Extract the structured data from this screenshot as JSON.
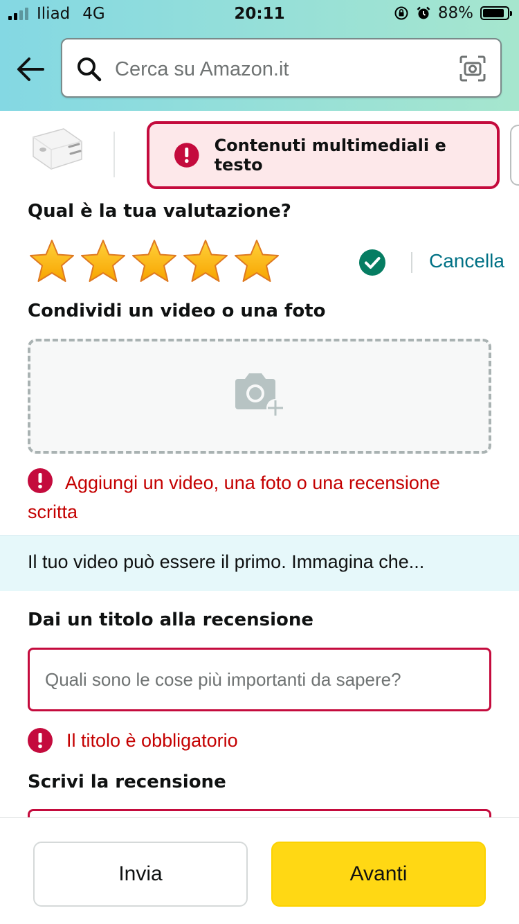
{
  "status_bar": {
    "carrier": "Iliad",
    "network": "4G",
    "time": "20:11",
    "battery": "88%",
    "battery_level": 0.88
  },
  "search": {
    "placeholder": "Cerca su Amazon.it"
  },
  "product_strip": {
    "alert_label": "Contenuti multimediali e testo"
  },
  "rating": {
    "title": "Qual è la tua valutazione?",
    "stars": 5,
    "max_stars": 5,
    "cancel_label": "Cancella"
  },
  "media": {
    "title": "Condividi un video o una foto",
    "error": "Aggiungi un video, una foto o una recensione scritta"
  },
  "banner": {
    "text": "Il tuo video può essere il primo. Immagina che..."
  },
  "review_title": {
    "label": "Dai un titolo alla recensione",
    "placeholder": "Quali sono le cose più importanti da sapere?",
    "value": "",
    "error": "Il titolo è obbligatorio"
  },
  "review_body": {
    "label": "Scrivi la recensione"
  },
  "footer": {
    "send_label": "Invia",
    "next_label": "Avanti"
  },
  "colors": {
    "error": "#c40000",
    "alert_border": "#c40b3d",
    "link": "#007185",
    "primary_button": "#ffd814",
    "star": "#ffb400",
    "check": "#067d62"
  }
}
